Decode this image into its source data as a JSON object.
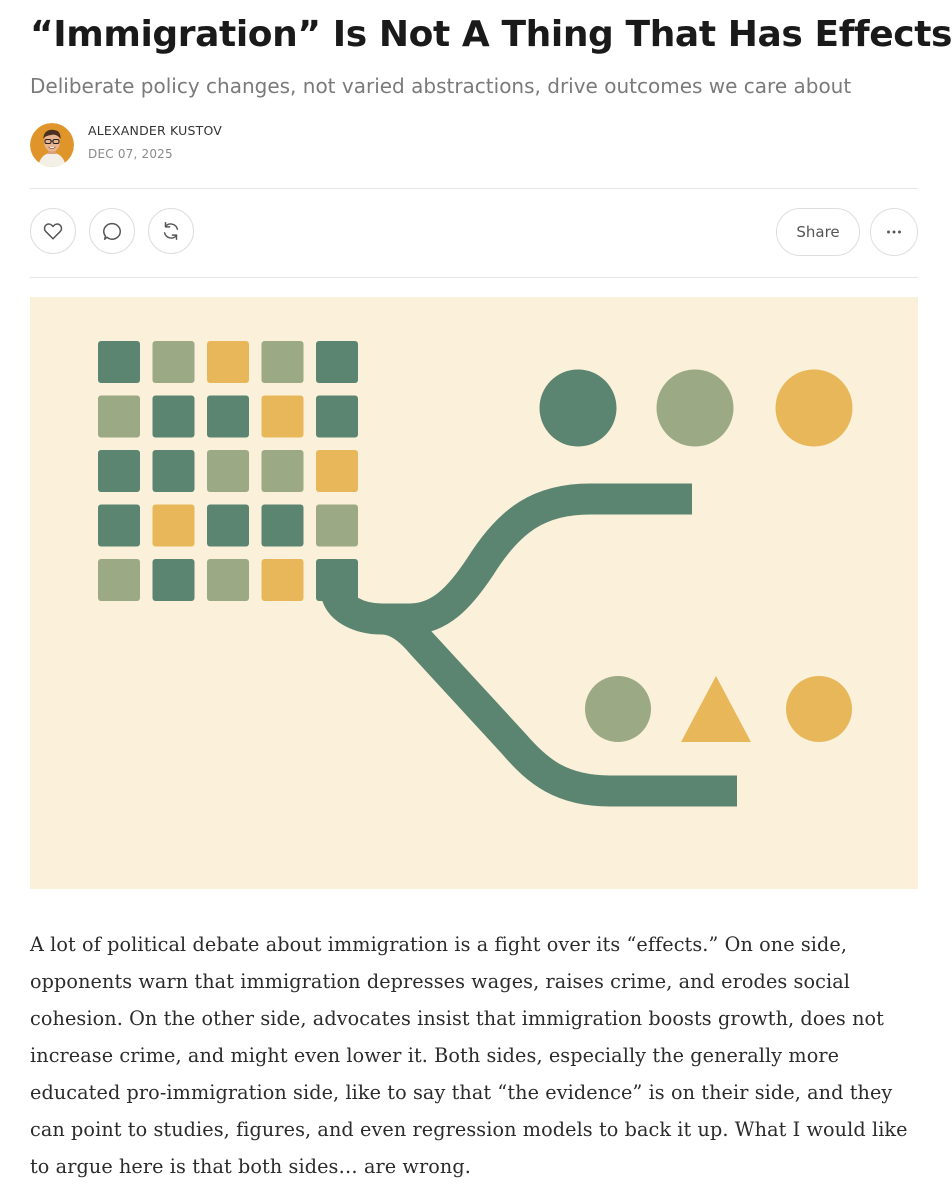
{
  "post": {
    "title": "“Immigration” Is Not A Thing That Has Effects",
    "subtitle": "Deliberate policy changes, not varied abstractions, drive outcomes we care about",
    "author": "ALEXANDER KUSTOV",
    "date": "DEC 07, 2025"
  },
  "actions": {
    "like_icon": "heart-icon",
    "comment_icon": "speech-bubble-icon",
    "restack_icon": "refresh-arrows-icon",
    "share_label": "Share",
    "more_icon": "ellipsis-icon"
  },
  "illustration": {
    "colors": {
      "background": "#fbf0d9",
      "green": "#5b8570",
      "sage": "#9ba985",
      "gold": "#e8b75a"
    },
    "grid": [
      [
        "green",
        "sage",
        "gold",
        "sage",
        "green"
      ],
      [
        "sage",
        "green",
        "green",
        "gold",
        "green"
      ],
      [
        "green",
        "green",
        "sage",
        "sage",
        "gold"
      ],
      [
        "green",
        "gold",
        "green",
        "green",
        "sage"
      ],
      [
        "sage",
        "green",
        "sage",
        "gold",
        "green"
      ]
    ],
    "upper_shapes": [
      {
        "shape": "circle",
        "color": "green"
      },
      {
        "shape": "circle",
        "color": "sage"
      },
      {
        "shape": "circle",
        "color": "gold"
      }
    ],
    "lower_shapes": [
      {
        "shape": "circle",
        "color": "sage"
      },
      {
        "shape": "triangle",
        "color": "gold"
      },
      {
        "shape": "circle",
        "color": "gold"
      }
    ]
  },
  "body": {
    "paragraph": "A lot of political debate about immigration is a fight over its “effects.” On one side, opponents warn that immigration depresses wages, raises crime, and erodes social cohesion. On the other side, advocates insist that immigration boosts growth, does not increase crime, and might even lower it. Both sides, especially the generally more educated pro-immigration side, like to say that “the evidence” is on their side, and they can point to studies, figures, and even regression models to back it up. What I would like to argue here is that both sides… are wrong."
  }
}
